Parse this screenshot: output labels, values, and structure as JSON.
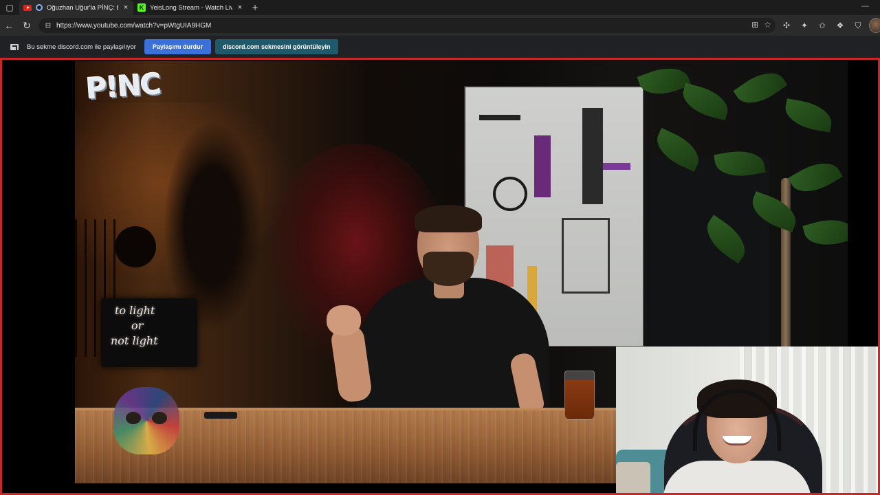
{
  "browser": {
    "tabs": [
      {
        "title": "Oğuzhan Uğur'la PİNÇ: Bölü",
        "active": true,
        "close": "×"
      },
      {
        "title": "YeisLong Stream - Watch Live on",
        "active": false,
        "close": "×"
      }
    ],
    "new_tab": "+",
    "minimize": "—",
    "url": "https://www.youtube.com/watch?v=pWtgUIA9HGM"
  },
  "sharebar": {
    "message": "Bu sekme discord.com ile paylaşılıyor",
    "stop_label": "Paylaşımı durdur",
    "view_label": "discord.com sekmesini görüntüleyin"
  },
  "video": {
    "logo": "P!NC",
    "neon_sign_lines": [
      "to light",
      "or",
      "not light"
    ]
  },
  "colors": {
    "share_border": "#c62828",
    "stop_button": "#3b72d9",
    "view_button": "#1e5a6b"
  }
}
